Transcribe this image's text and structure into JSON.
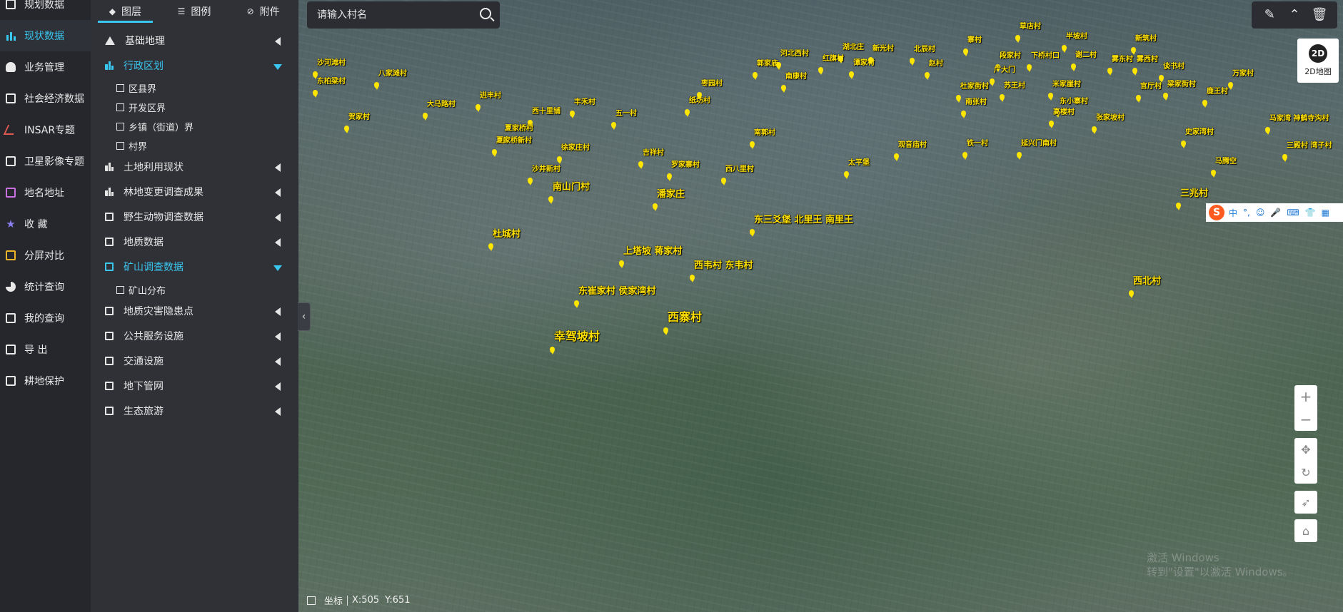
{
  "nav": [
    {
      "label": "规划数据",
      "icon": "plan-icon"
    },
    {
      "label": "现状数据",
      "icon": "bar-chart-icon",
      "active": true
    },
    {
      "label": "业务管理",
      "icon": "user-icon"
    },
    {
      "label": "社会经济数据",
      "icon": "economy-icon"
    },
    {
      "label": "INSAR专题",
      "icon": "wave-icon"
    },
    {
      "label": "卫星影像专题",
      "icon": "satellite-icon"
    },
    {
      "label": "地名地址",
      "icon": "address-icon"
    },
    {
      "label": "收 藏",
      "icon": "star-icon"
    },
    {
      "label": "分屏对比",
      "icon": "monitor-icon"
    },
    {
      "label": "统计查询",
      "icon": "pie-chart-icon"
    },
    {
      "label": "我的查询",
      "icon": "query-icon"
    },
    {
      "label": "导 出",
      "icon": "export-icon"
    },
    {
      "label": "耕地保护",
      "icon": "farmland-icon"
    }
  ],
  "tabs": [
    {
      "label": "图层",
      "icon": "layers-icon",
      "active": true
    },
    {
      "label": "图例",
      "icon": "list-icon"
    },
    {
      "label": "附件",
      "icon": "paperclip-icon"
    }
  ],
  "layers": [
    {
      "label": "基础地理",
      "open": false
    },
    {
      "label": "行政区划",
      "open": true,
      "children": [
        "区县界",
        "开发区界",
        "乡镇（街道）界",
        "村界"
      ]
    },
    {
      "label": "土地利用现状",
      "open": false
    },
    {
      "label": "林地变更调查成果",
      "open": false
    },
    {
      "label": "野生动物调查数据",
      "open": false
    },
    {
      "label": "地质数据",
      "open": false
    },
    {
      "label": "矿山调查数据",
      "open": true,
      "children": [
        "矿山分布"
      ]
    },
    {
      "label": "地质灾害隐患点",
      "open": false
    },
    {
      "label": "公共服务设施",
      "open": false
    },
    {
      "label": "交通设施",
      "open": false
    },
    {
      "label": "地下管网",
      "open": false
    },
    {
      "label": "生态旅游",
      "open": false
    }
  ],
  "search": {
    "placeholder": "请输入村名"
  },
  "mode": {
    "badge": "2D",
    "label": "2D地图"
  },
  "coords": {
    "label": "坐标",
    "x": "X:505",
    "y": "Y:651"
  },
  "watermark": {
    "line1": "激活 Windows",
    "line2": "转到\"设置\"以激活 Windows。"
  },
  "ime": {
    "items": [
      "中",
      "°,",
      "☺",
      "🎤",
      "⌨",
      "👕",
      "▦"
    ]
  },
  "villages": [
    {
      "name": "沙河滩村",
      "size": "s"
    },
    {
      "name": "八家滩村",
      "size": "s"
    },
    {
      "name": "东柏梁村",
      "size": "s"
    },
    {
      "name": "贺家村",
      "size": "s"
    },
    {
      "name": "大马路村",
      "size": "s"
    },
    {
      "name": "进丰村",
      "size": "s"
    },
    {
      "name": "丰禾村",
      "size": "s"
    },
    {
      "name": "五一村",
      "size": "s"
    },
    {
      "name": "西十里铺",
      "size": "s"
    },
    {
      "name": "夏家桥村",
      "size": "s"
    },
    {
      "name": "夏家桥新村",
      "size": "s"
    },
    {
      "name": "徐家庄村",
      "size": "s"
    },
    {
      "name": "沙井新村",
      "size": "s"
    },
    {
      "name": "吉祥村",
      "size": "s"
    },
    {
      "name": "罗家寨村",
      "size": "s"
    },
    {
      "name": "西八里村",
      "size": "s"
    },
    {
      "name": "南山门村",
      "size": "m"
    },
    {
      "name": "潘家庄",
      "size": "m"
    },
    {
      "name": "杜城村",
      "size": "m"
    },
    {
      "name": "上塔坡 蒋家村",
      "size": "m"
    },
    {
      "name": "西韦村 东韦村",
      "size": "m"
    },
    {
      "name": "东三爻堡 北里王 南里王",
      "size": "m"
    },
    {
      "name": "东崔家村 侯家湾村",
      "size": "m"
    },
    {
      "name": "西寨村",
      "size": "l"
    },
    {
      "name": "幸驾坡村",
      "size": "l"
    },
    {
      "name": "西北村",
      "size": "m"
    },
    {
      "name": "太平堡",
      "size": "s"
    },
    {
      "name": "观音庙村",
      "size": "s"
    },
    {
      "name": "铁一村",
      "size": "s"
    },
    {
      "name": "延兴门南村",
      "size": "s"
    },
    {
      "name": "南郭村",
      "size": "s"
    },
    {
      "name": "纸坊村",
      "size": "s"
    },
    {
      "name": "枣园村",
      "size": "s"
    },
    {
      "name": "郭家庙",
      "size": "s"
    },
    {
      "name": "河北西村",
      "size": "s"
    },
    {
      "name": "南康村",
      "size": "s"
    },
    {
      "name": "红旗村",
      "size": "s"
    },
    {
      "name": "湖北庄",
      "size": "s"
    },
    {
      "name": "谭家村",
      "size": "s"
    },
    {
      "name": "新光村",
      "size": "s"
    },
    {
      "name": "北辰村",
      "size": "s"
    },
    {
      "name": "赵村",
      "size": "s"
    },
    {
      "name": "寨村",
      "size": "s"
    },
    {
      "name": "草店村",
      "size": "s"
    },
    {
      "name": "半坡村",
      "size": "s"
    },
    {
      "name": "新筑村",
      "size": "s"
    },
    {
      "name": "段家村",
      "size": "s"
    },
    {
      "name": "下桥村口",
      "size": "s"
    },
    {
      "name": "谢二村",
      "size": "s"
    },
    {
      "name": "雾东村",
      "size": "s"
    },
    {
      "name": "雾西村",
      "size": "s"
    },
    {
      "name": "谈书村",
      "size": "s"
    },
    {
      "name": "广大门",
      "size": "s"
    },
    {
      "name": "万家村",
      "size": "s"
    },
    {
      "name": "杜家街村",
      "size": "s"
    },
    {
      "name": "苏王村",
      "size": "s"
    },
    {
      "name": "米家崖村",
      "size": "s"
    },
    {
      "name": "官厅村",
      "size": "s"
    },
    {
      "name": "梁家街村",
      "size": "s"
    },
    {
      "name": "鹿王村",
      "size": "s"
    },
    {
      "name": "南张村",
      "size": "s"
    },
    {
      "name": "东小寨村",
      "size": "s"
    },
    {
      "name": "高楼村",
      "size": "s"
    },
    {
      "name": "张家坡村",
      "size": "s"
    },
    {
      "name": "马家湾 神鹤寺沟村",
      "size": "s"
    },
    {
      "name": "史家湾村",
      "size": "s"
    },
    {
      "name": "三殿村 湾子村",
      "size": "s"
    },
    {
      "name": "马腾空",
      "size": "s"
    },
    {
      "name": "三兆村",
      "size": "m"
    }
  ]
}
